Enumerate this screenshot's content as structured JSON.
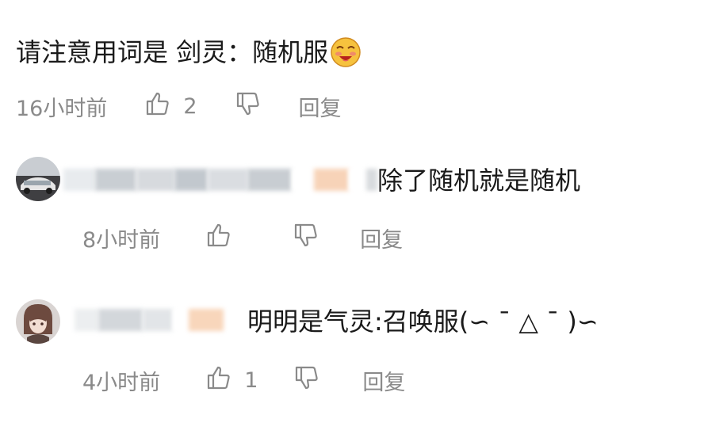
{
  "comments": [
    {
      "text": "请注意用词是 剑灵：随机服",
      "emoji": "laughing-face-emoji",
      "time": "16小时前",
      "likes": "2",
      "reply_label": "回复"
    },
    {
      "text": "除了随机就是随机",
      "avatar": "car-photo-avatar",
      "time": "8小时前",
      "likes": "",
      "reply_label": "回复"
    },
    {
      "text": "明明是气灵:召唤服(∽ ˉ △ ˉ )∽",
      "avatar": "anime-character-avatar",
      "time": "4小时前",
      "likes": "1",
      "reply_label": "回复"
    }
  ],
  "colors": {
    "text": "#1a1a1a",
    "meta": "#8a8a8a",
    "background": "#ffffff"
  },
  "icons": {
    "like": "thumbs-up-icon",
    "dislike": "thumbs-down-icon"
  }
}
